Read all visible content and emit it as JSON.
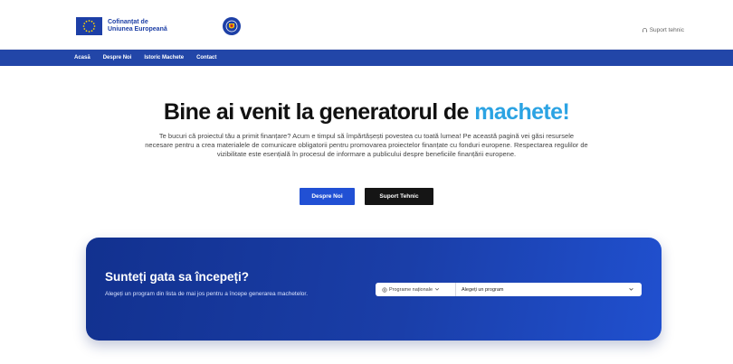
{
  "header": {
    "eu_logo_line1": "Cofinanțat de",
    "eu_logo_line2": "Uniunea Europeană",
    "support_label": "Suport tehnic"
  },
  "nav": {
    "items": [
      "Acasă",
      "Despre Noi",
      "Istoric Machete",
      "Contact"
    ]
  },
  "hero": {
    "title_main": "Bine ai venit la generatorul de ",
    "title_accent": "machete!",
    "paragraph": "Te bucuri că proiectul tău a primit finanțare? Acum e timpul să împărtășești povestea cu toată lumea! Pe această pagină vei găsi resursele necesare pentru a crea materialele de comunicare obligatorii pentru promovarea proiectelor finanțate cu fonduri europene. Respectarea regulilor de vizibilitate este esențială în procesul de informare a publicului despre beneficiile finanțării europene.",
    "primary_button": "Despre Noi",
    "secondary_button": "Suport Tehnic"
  },
  "cta": {
    "title": "Sunteți gata sa începeți?",
    "subtitle": "Alegeți un program din lista de mai jos pentru a începe generarea machetelor.",
    "category_select": "Programe naționale",
    "program_select_placeholder": "Alegeți un program"
  },
  "colors": {
    "brand_blue": "#2246a8",
    "accent": "#2ba3e3",
    "primary_button": "#2150d4"
  }
}
